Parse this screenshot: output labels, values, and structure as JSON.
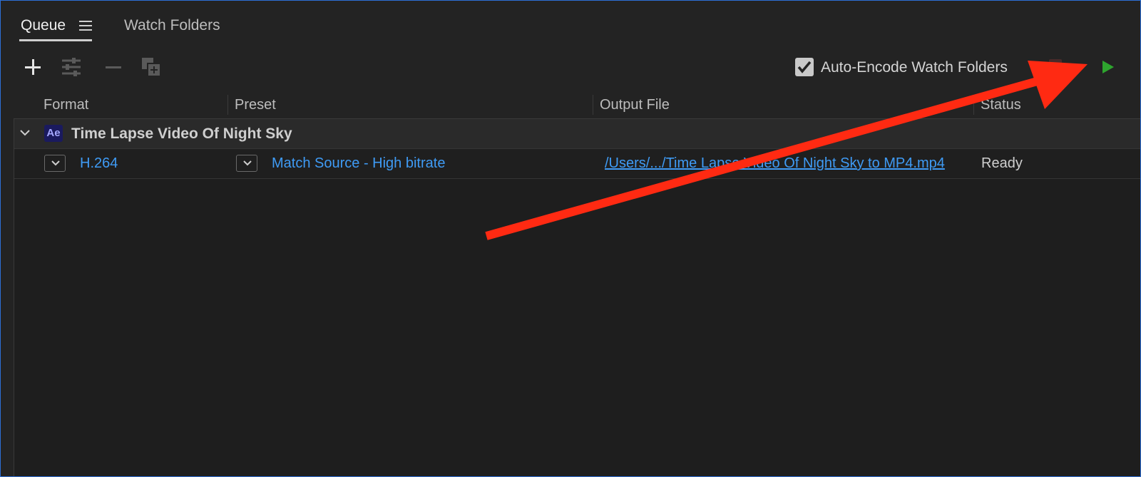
{
  "tabs": [
    {
      "label": "Queue",
      "active": true
    },
    {
      "label": "Watch Folders",
      "active": false
    }
  ],
  "toolbar": {
    "auto_encode_label": "Auto-Encode Watch Folders",
    "auto_encode_checked": true
  },
  "columns": {
    "format": "Format",
    "preset": "Preset",
    "output": "Output File",
    "status": "Status"
  },
  "queue": {
    "group": {
      "badge": "Ae",
      "title": "Time Lapse Video Of Night Sky"
    },
    "item": {
      "format": "H.264",
      "preset": "Match Source - High bitrate",
      "output": "/Users/.../Time Lapse Video Of Night Sky to MP4.mp4",
      "status": "Ready"
    }
  },
  "colors": {
    "accent_link": "#3f9bf5",
    "play_green": "#2ea52e",
    "annotation_red": "#ff2a12",
    "panel_bg": "#232323",
    "focus_border": "#2d6fd6"
  },
  "icons": [
    "menu-icon",
    "plus-icon",
    "settings-icon",
    "minus-icon",
    "duplicate-icon",
    "checkmark-icon",
    "stop-icon",
    "play-icon",
    "chevron-down-icon",
    "ae-badge"
  ]
}
